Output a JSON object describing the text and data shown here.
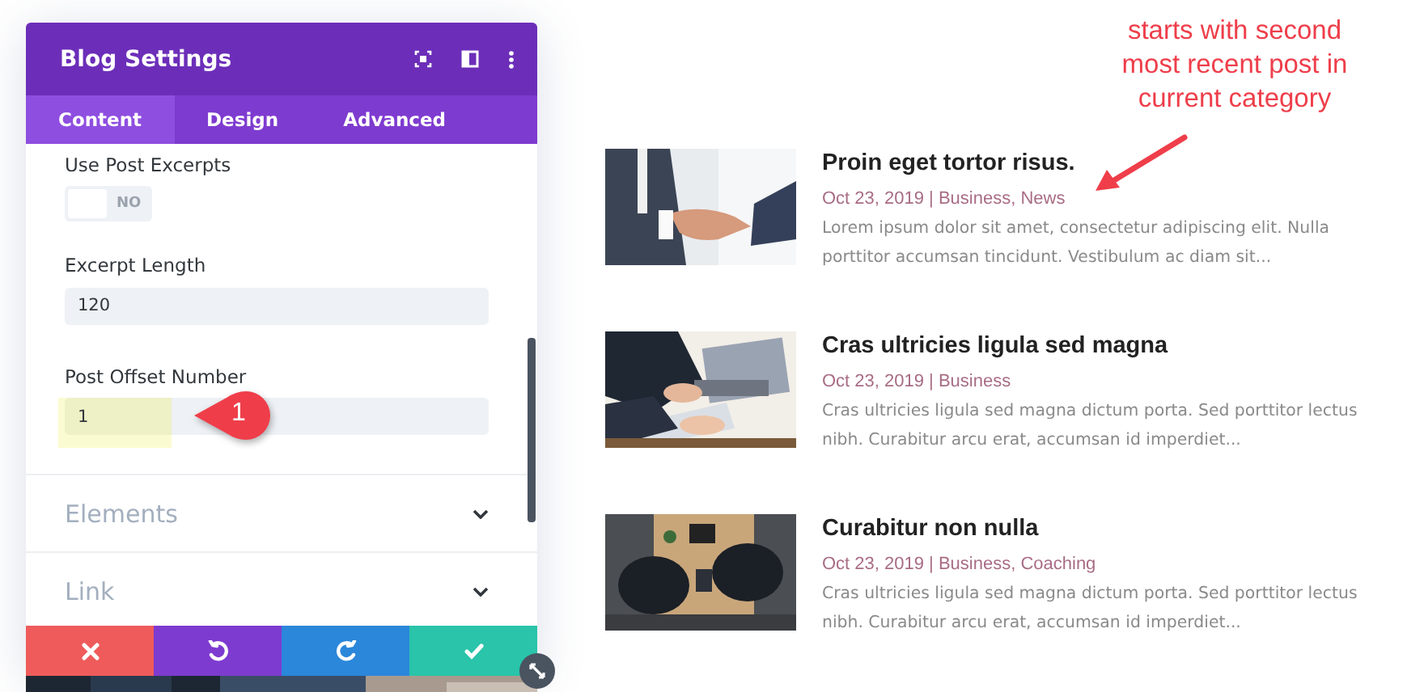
{
  "settings": {
    "title": "Blog Settings",
    "tabs": [
      {
        "label": "Content",
        "selected": true
      },
      {
        "label": "Design",
        "selected": false
      },
      {
        "label": "Advanced",
        "selected": false
      }
    ],
    "fields": [
      {
        "kind": "toggle",
        "label": "Use Post Excerpts",
        "on": false,
        "value": "NO"
      },
      {
        "kind": "input",
        "label": "Excerpt Length",
        "value": "120",
        "highlighted": false
      },
      {
        "kind": "input",
        "label": "Post Offset Number",
        "value": "1",
        "highlighted": true,
        "callout": "1"
      }
    ],
    "sections": [
      {
        "label": "Elements",
        "expanded": false
      },
      {
        "label": "Link",
        "expanded": false
      }
    ],
    "actions": [
      {
        "kind": "cancel",
        "color": "#ef5b5b"
      },
      {
        "kind": "undo",
        "color": "#7e3bd0"
      },
      {
        "kind": "redo",
        "color": "#2b87da"
      },
      {
        "kind": "save",
        "color": "#29c4a9"
      }
    ]
  },
  "annotation": "starts with second most recent post in current category",
  "posts": [
    {
      "title": "Proin eget tortor risus.",
      "meta": "Oct 23, 2019 | Business, News",
      "excerpt": "Lorem ipsum dolor sit amet, consectetur adipiscing elit. Nulla porttitor accumsan tincidunt. Vestibulum ac diam sit..."
    },
    {
      "title": "Cras ultricies ligula sed magna",
      "meta": "Oct 23, 2019 | Business",
      "excerpt": "Cras ultricies ligula sed magna dictum porta. Sed porttitor lectus nibh. Curabitur arcu erat, accumsan id imperdiet..."
    },
    {
      "title": "Curabitur non nulla",
      "meta": "Oct 23, 2019 | Business, Coaching",
      "excerpt": "Cras ultricies ligula sed magna dictum porta. Sed porttitor lectus nibh. Curabitur arcu erat, accumsan id imperdiet..."
    }
  ]
}
